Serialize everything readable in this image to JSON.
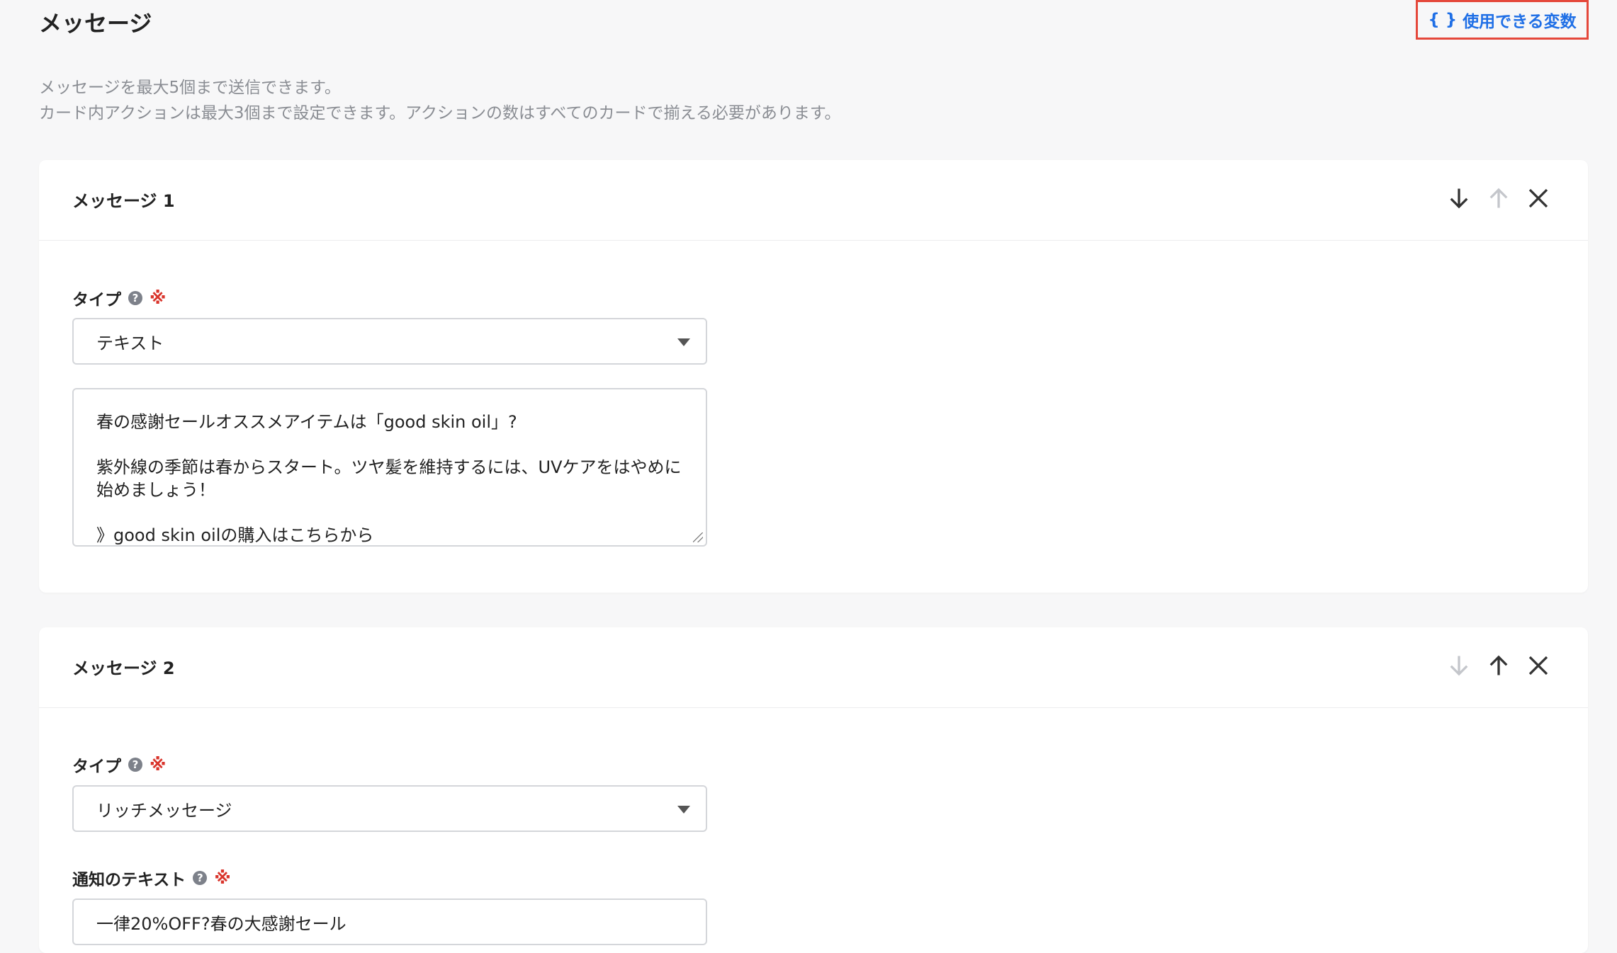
{
  "page": {
    "title": "メッセージ",
    "vars_button": {
      "brace": "{ }",
      "label": "使用できる変数"
    },
    "description": [
      "メッセージを最大5個まで送信できます。",
      "カード内アクションは最大3個まで設定できます。アクションの数はすべてのカードで揃える必要があります。"
    ]
  },
  "messages": [
    {
      "title": "メッセージ 1",
      "type_label": "タイプ",
      "type_value": "テキスト",
      "text_lines": [
        "春の感謝セールオススメアイテムは「good skin oil」?",
        "",
        "紫外線の季節は春からスタート。ツヤ髪を維持するには、UVケアをはやめに",
        "始めましょう！",
        "",
        "》good skin oilの購入はこちらから"
      ],
      "controls": {
        "down_enabled": true,
        "up_enabled": false
      }
    },
    {
      "title": "メッセージ 2",
      "type_label": "タイプ",
      "type_value": "リッチメッセージ",
      "notification_label": "通知のテキスト",
      "notification_value": "一律20%OFF?春の大感謝セール",
      "controls": {
        "down_enabled": false,
        "up_enabled": true
      }
    }
  ],
  "common": {
    "help_glyph": "?",
    "required_mark": "※"
  },
  "colors": {
    "accent": "#1f6fe6",
    "highlight_border": "#e5483b",
    "required": "#d9342b",
    "icon_active": "#333333",
    "icon_disabled": "#c4c6cb"
  }
}
